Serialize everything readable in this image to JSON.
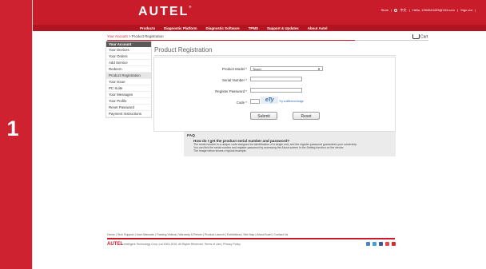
{
  "step": {
    "number": "1"
  },
  "header": {
    "logo": "AUTEL",
    "logo_mark": "®",
    "top_links": [
      "Store",
      "|",
      "中文",
      "|",
      "Hello, 1354543499@163.com",
      "|",
      "Sign out",
      "|"
    ]
  },
  "menu": [
    "Products",
    "Diagnostic Platform",
    "Diagnostic Software",
    "TPMS",
    "Support & Updates",
    "About Autel"
  ],
  "breadcrumb": {
    "link": "Your Account",
    "sep": " > ",
    "current": "Product Registration"
  },
  "cart": {
    "label": "Cart"
  },
  "sidebar": {
    "header": "Your Account",
    "items": [
      "Your Devices",
      "Your Orders",
      "Add Service",
      "Redeem",
      "Product Registration",
      "Your Issue",
      "PC Suite",
      "Your Messages",
      "Your Profile",
      "Reset Password",
      "Payment Instructions"
    ],
    "active_index": 4
  },
  "page_title": "Product Registration",
  "form": {
    "product_model_label": "Product Model *",
    "product_model_value": "Teach",
    "serial_number_label": "Serial Number *",
    "serial_number_value": "",
    "register_password_label": "Register Password *",
    "register_password_value": "",
    "code_label": "Code *",
    "code_value": "",
    "captcha_text": "eTy",
    "different_image_link": "Try a different image",
    "submit_label": "Submit",
    "reset_label": "Reset"
  },
  "faq": {
    "title": "FAQ",
    "question": "How do I get the product serial number and password?",
    "answer_lines": [
      "The serial number is a unique code assigned for identification of a single unit, and the register password guarantees your ownership.",
      "You can find the serial number and register password by accessing the About screen in the Setting function on the device.",
      "The image below shows a typical example."
    ]
  },
  "footer": {
    "links": "Home  |  Tech Support  |  User Manuals  |  Training Videos  |  Warranty & Return  |  Product Launch  |  Exhibitions  |  Site Map  |  About Autel  |  Contact Us",
    "logo": "AUTEL",
    "copyright": "© Intelligent Technology Corp.,Ltd 2004-2015, All Rights Reserved.  Terms of Use  |  Privacy Policy"
  },
  "colors": {
    "brand_red": "#c91c2b",
    "step_red": "#cf2231",
    "sidebar_header": "#595959"
  }
}
